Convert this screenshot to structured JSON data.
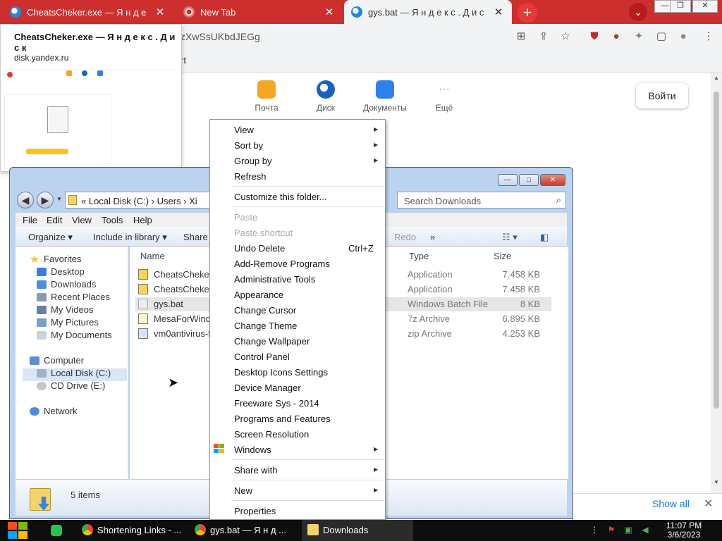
{
  "browser": {
    "tabs": [
      {
        "title": "CheatsCheker.exe — Я н д е",
        "close": "✕"
      },
      {
        "title": "New Tab",
        "close": "✕"
      },
      {
        "title": "gys.bat — Я н д е к с . Д и с",
        "close": "✕"
      }
    ],
    "new_tab": "+",
    "downloads_chevron": "⌄",
    "window_controls": {
      "minimize": "—",
      "restore": "❐",
      "close": "✕"
    },
    "address": "zXwSsUKbdJEGg",
    "bookmarks_fragment": "rt",
    "page": {
      "services": [
        {
          "label": "Почта",
          "color": "#f5a623"
        },
        {
          "label": "Диск",
          "color": "#1565c0"
        },
        {
          "label": "Документы",
          "color": "#2f80ed"
        },
        {
          "label": "Ещё",
          "glyph": "···"
        }
      ],
      "login_label": "Войти"
    },
    "download_bar": {
      "show_all": "Show all",
      "close": "✕"
    }
  },
  "tab_preview": {
    "title": "CheatsCheker.exe — Я н д е к с . Д и с к",
    "url": "disk.yandex.ru"
  },
  "explorer": {
    "title_buttons": {
      "minimize": "—",
      "maximize": "□",
      "close": "✕"
    },
    "breadcrumb": "«  Local Disk (C:)  ›  Users  ›  Xi",
    "search_placeholder": "Search Downloads",
    "menu": [
      "File",
      "Edit",
      "View",
      "Tools",
      "Help"
    ],
    "commands": {
      "organize": "Organize ▾",
      "include": "Include in library ▾",
      "share": "Share",
      "redo": "Redo",
      "more": "»"
    },
    "nav": {
      "favorites": "Favorites",
      "desktop": "Desktop",
      "downloads": "Downloads",
      "recent": "Recent Places",
      "videos": "My Videos",
      "pictures": "My Pictures",
      "documents": "My Documents",
      "computer": "Computer",
      "local_disk": "Local Disk (C:)",
      "cd_drive": "CD Drive (E:)",
      "network": "Network"
    },
    "columns": {
      "name": "Name",
      "type": "Type",
      "size": "Size"
    },
    "files": [
      {
        "name": "CheatsCheker",
        "type": "Application",
        "size": "7.458 KB"
      },
      {
        "name": "CheatsCheker",
        "type": "Application",
        "size": "7.458 KB"
      },
      {
        "name": "gys.bat",
        "type": "Windows Batch File",
        "size": "8 KB"
      },
      {
        "name": "MesaForWindo",
        "type": "7z Archive",
        "size": "6.895 KB"
      },
      {
        "name": "vm0antivirus-f",
        "type": "zip Archive",
        "size": "4.253 KB"
      }
    ],
    "status": "5 items"
  },
  "context_menu": {
    "view": "View",
    "sort_by": "Sort by",
    "group_by": "Group by",
    "refresh": "Refresh",
    "customize": "Customize this folder...",
    "paste": "Paste",
    "paste_shortcut": "Paste shortcut",
    "undo_delete": "Undo Delete",
    "undo_shortcut": "Ctrl+Z",
    "add_remove": "Add-Remove Programs",
    "admin_tools": "Administrative Tools",
    "appearance": "Appearance",
    "change_cursor": "Change Cursor",
    "change_theme": "Change Theme",
    "change_wallpaper": "Change Wallpaper",
    "control_panel": "Control Panel",
    "desktop_icons": "Desktop Icons Settings",
    "device_manager": "Device Manager",
    "freeware": "Freeware Sys - 2014",
    "programs_features": "Programs and Features",
    "screen_resolution": "Screen Resolution",
    "windows": "Windows",
    "share_with": "Share with",
    "new": "New",
    "properties": "Properties"
  },
  "taskbar": {
    "items": [
      {
        "label": "Shortening Links - ...",
        "icon": "chrome-icon"
      },
      {
        "label": "gys.bat — Я н д ...",
        "icon": "chrome-icon"
      },
      {
        "label": "Downloads",
        "icon": "folder-icon"
      }
    ],
    "time": "11:07 PM",
    "date": "3/6/2023"
  }
}
